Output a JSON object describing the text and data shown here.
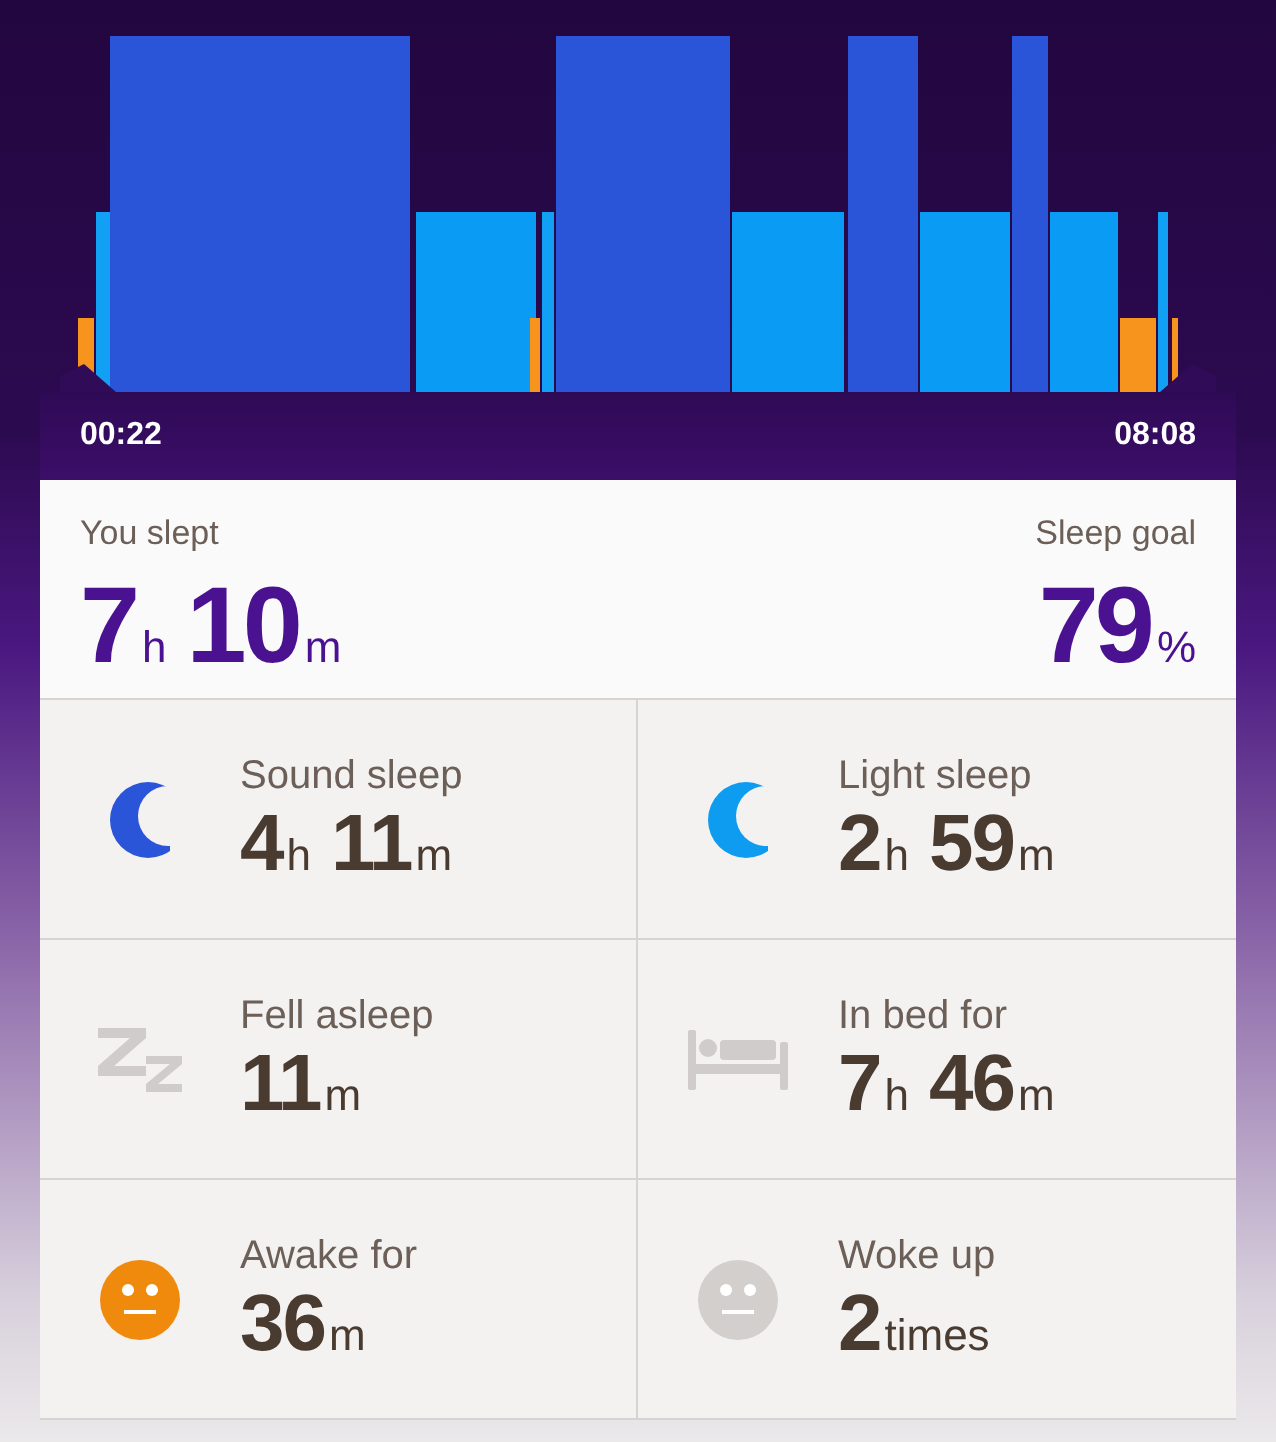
{
  "chart": {
    "start_time": "00:22",
    "end_time": "08:08"
  },
  "summary": {
    "slept_label": "You slept",
    "slept": [
      {
        "value": "7",
        "unit": "h"
      },
      {
        "value": "10",
        "unit": "m"
      }
    ],
    "goal_label": "Sleep goal",
    "goal": [
      {
        "value": "79",
        "unit": "%"
      }
    ]
  },
  "stats": [
    {
      "kind": "sound-sleep",
      "label": "Sound sleep",
      "value": [
        {
          "value": "4",
          "unit": "h"
        },
        {
          "value": "11",
          "unit": "m"
        }
      ]
    },
    {
      "kind": "light-sleep",
      "label": "Light sleep",
      "value": [
        {
          "value": "2",
          "unit": "h"
        },
        {
          "value": "59",
          "unit": "m"
        }
      ]
    },
    {
      "kind": "fell-asleep",
      "label": "Fell asleep",
      "value": [
        {
          "value": "11",
          "unit": "m"
        }
      ]
    },
    {
      "kind": "in-bed",
      "label": "In bed for",
      "value": [
        {
          "value": "7",
          "unit": "h"
        },
        {
          "value": "46",
          "unit": "m"
        }
      ]
    },
    {
      "kind": "awake",
      "label": "Awake for",
      "value": [
        {
          "value": "36",
          "unit": "m"
        }
      ]
    },
    {
      "kind": "woke-up",
      "label": "Woke up",
      "value": [
        {
          "value": "2",
          "unit": "times"
        }
      ]
    }
  ]
}
